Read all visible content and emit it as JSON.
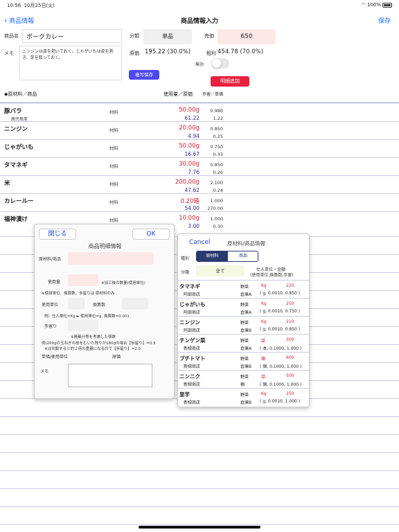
{
  "status": {
    "time": "10:56",
    "date": "10月25日(火)",
    "battery": "100%"
  },
  "nav": {
    "back_label": "商品情報",
    "title": "商品情報入力",
    "save_label": "保存"
  },
  "form": {
    "name_label": "商品名",
    "name_value": "ポークカレー",
    "category_label": "分類",
    "category_value": "単品",
    "price_label": "売価",
    "price_value": "650",
    "memo_label": "メモ",
    "memo_value": "ニンジンは皮を剥いておく。じゃがいもは皮を剥き、芽を取っておく。",
    "cost_label": "原価",
    "cost_value": "195.22 (30.0%)",
    "gross_label": "粗利",
    "gross_value": "454.78 (70.0%)",
    "copy_save_label": "複写保存",
    "invalid_label": "無効",
    "add_detail_label": "明細追加",
    "invalid_on": false
  },
  "list_header": {
    "title": "◆原材料／商品",
    "col1": "使用量／原価",
    "col2": "歩留／単価"
  },
  "ingredients": [
    {
      "name": "豚バラ",
      "sub": "鹿児島産",
      "cat": "材料",
      "amount": "50.00g",
      "cost": "61.22",
      "r1": "0.980",
      "r2": "1.22"
    },
    {
      "name": "ニンジン",
      "sub": "",
      "cat": "材料",
      "amount": "20.00g",
      "cost": "4.94",
      "r1": "0.850",
      "r2": "0.25"
    },
    {
      "name": "じゃがいも",
      "sub": "",
      "cat": "材料",
      "amount": "50.00g",
      "cost": "16.67",
      "r1": "0.750",
      "r2": "0.33"
    },
    {
      "name": "タマネギ",
      "sub": "",
      "cat": "材料",
      "amount": "30.00g",
      "cost": "7.76",
      "r1": "0.850",
      "r2": "0.26"
    },
    {
      "name": "米",
      "sub": "",
      "cat": "材料",
      "amount": "200.00g",
      "cost": "47.62",
      "r1": "2.100",
      "r2": "0.24"
    },
    {
      "name": "カレールー",
      "sub": "",
      "cat": "材料",
      "amount": "0.20箱",
      "cost": "54.00",
      "r1": "1.000",
      "r2": "270.00"
    },
    {
      "name": "福神漬け",
      "sub": "",
      "cat": "材料",
      "amount": "10.00g",
      "cost": "3.00",
      "r1": "1.000",
      "r2": "0.30"
    }
  ],
  "detail": {
    "close_label": "閉じる",
    "ok_label": "OK",
    "title": "商品明細情報",
    "material_label": "原材料/商品",
    "usage_label": "使用量",
    "usage_note": "※加工後の数量(使用単位)",
    "note1": "※使用単位、換算数、歩留りは 原材料のみ",
    "unit_label": "使用単位",
    "conv_label": "換算数",
    "example1": "例）仕入単位=Kg ► 使用単位=g, 換算数=0.001",
    "yield_label": "歩留り",
    "yield_note": "※廃棄分等を考慮した係数",
    "example2": "例)200gの玉ねぎの皮をむいた残りが180gの場合【歩留り】=0.9",
    "example3": "※は炊飯すると約２倍の重量になるので【歩留り】=2.0",
    "unitcost_label": "単価/使用単位",
    "genka_label": "原価",
    "memo_label": "メモ"
  },
  "picker": {
    "cancel_label": "Cancel",
    "title": "原材料/商品情報",
    "type_label": "種別",
    "seg_material": "原材料",
    "seg_product": "商品",
    "cat_label": "分類",
    "cat_all": "全て",
    "unit_header1": "仕入単位・金額",
    "unit_header2": "(使用単位,換算数,歩留)",
    "items": [
      {
        "name": "タマネギ",
        "shop": "阿部商店",
        "genre": "野菜",
        "loc": "倉庫A",
        "unit": "Kg",
        "price": "220",
        "detail": "( g, 0.0010, 0.850 )"
      },
      {
        "name": "じゃがいも",
        "shop": "阿部商店",
        "genre": "野菜",
        "loc": "倉庫A",
        "unit": "Kg",
        "price": "250",
        "detail": "( g, 0.0010, 0.750 )"
      },
      {
        "name": "ニンジン",
        "shop": "阿部商店",
        "genre": "野菜",
        "loc": "倉庫B",
        "unit": "Kg",
        "price": "210",
        "detail": "( g, 0.0010, 0.850 )"
      },
      {
        "name": "チンゲン菜",
        "shop": "新緑商店",
        "genre": "野菜",
        "loc": "倉庫A",
        "unit": "袋",
        "price": "300",
        "detail": "( 本, 0.1000, 1.000 )"
      },
      {
        "name": "プチトマト",
        "shop": "新緑商店",
        "genre": "野菜",
        "loc": "倉庫B",
        "unit": "箱",
        "price": "600",
        "detail": "( 個, 0.1000, 1.000 )"
      },
      {
        "name": "ニンニク",
        "shop": "新緑商店",
        "genre": "野菜",
        "loc": "棚",
        "unit": "袋",
        "price": "500",
        "detail": "( 個, 0.1000, 1.000 )"
      },
      {
        "name": "里芋",
        "shop": "新緑商店",
        "genre": "野菜",
        "loc": "倉庫B",
        "unit": "Kg",
        "price": "250",
        "detail": "( g, 0.0010, 1.000 )"
      }
    ]
  }
}
